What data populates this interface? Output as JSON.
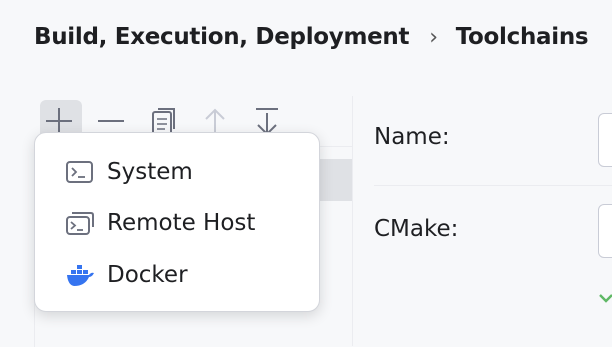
{
  "breadcrumb": {
    "parent": "Build, Execution, Deployment",
    "separator": "›",
    "current": "Toolchains"
  },
  "toolbar": {
    "buttons": [
      {
        "name": "add",
        "icon": "plus-icon"
      },
      {
        "name": "remove",
        "icon": "minus-icon"
      },
      {
        "name": "copy",
        "icon": "copy-icon"
      },
      {
        "name": "move-up",
        "icon": "arrow-up-icon"
      },
      {
        "name": "move-down",
        "icon": "arrow-down-icon"
      }
    ]
  },
  "add_menu": {
    "items": [
      {
        "label": "System",
        "icon": "terminal-icon"
      },
      {
        "label": "Remote Host",
        "icon": "remote-terminal-icon"
      },
      {
        "label": "Docker",
        "icon": "docker-icon"
      }
    ]
  },
  "form": {
    "name_label": "Name:",
    "cmake_label": "CMake:"
  },
  "colors": {
    "accent": "#3574f0",
    "selection": "#dfe1e5",
    "success": "#5fb865"
  }
}
